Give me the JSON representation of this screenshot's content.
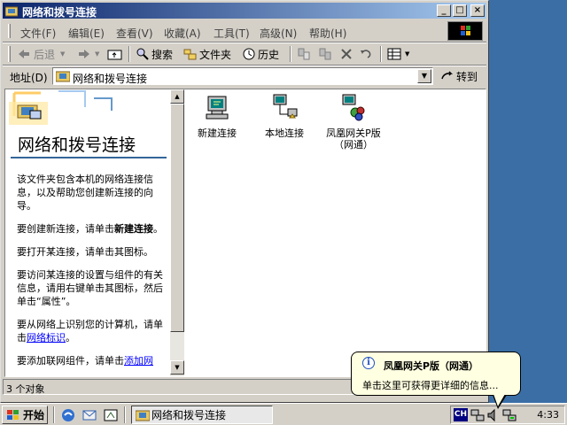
{
  "window": {
    "title": "网络和拨号连接",
    "minimize": "_",
    "maximize": "□",
    "close": "×"
  },
  "menu": [
    "文件(F)",
    "编辑(E)",
    "查看(V)",
    "收藏(A)",
    "工具(T)",
    "高级(N)",
    "帮助(H)"
  ],
  "toolbar": {
    "back": "后退",
    "search": "搜索",
    "folders": "文件夹",
    "history": "历史"
  },
  "address": {
    "label": "地址(D)",
    "value": "网络和拨号连接",
    "go": "转到"
  },
  "left_pane": {
    "title": "网络和拨号连接",
    "p1": "该文件夹包含本机的网络连接信息，以及帮助您创建新连接的向导。",
    "p2_a": "要创建新连接，请单击",
    "p2_b": "新建连接",
    "p2_c": "。",
    "p3": "要打开某连接，请单击其图标。",
    "p4": "要访问某连接的设置与组件的有关信息，请用右键单击其图标，然后单击“属性”。",
    "p5_a": "要从网络上识别您的计算机，请单击",
    "p5_link": "网络标识",
    "p5_c": "。",
    "p6_a": "要添加联网组件，请单击",
    "p6_link": "添加网"
  },
  "items": [
    {
      "label": "新建连接",
      "icon": "new-connection-icon"
    },
    {
      "label": "本地连接",
      "icon": "local-connection-icon"
    },
    {
      "label": "凤凰网关P版（网通）",
      "icon": "dialup-connection-icon"
    }
  ],
  "status": {
    "text": "3 个对象"
  },
  "taskbar": {
    "start": "开始",
    "task": "网络和拨号连接",
    "ime": "CH",
    "clock": "4:33"
  },
  "balloon": {
    "title": "凤凰网关P版（网通）",
    "text": "单击这里可获得更详细的信息..."
  },
  "colors": {
    "desktop": "#3a6ea5",
    "title_active": "#0a246a",
    "face": "#d4d0c8",
    "tooltip": "#ffffe1",
    "link": "#0000ff"
  }
}
